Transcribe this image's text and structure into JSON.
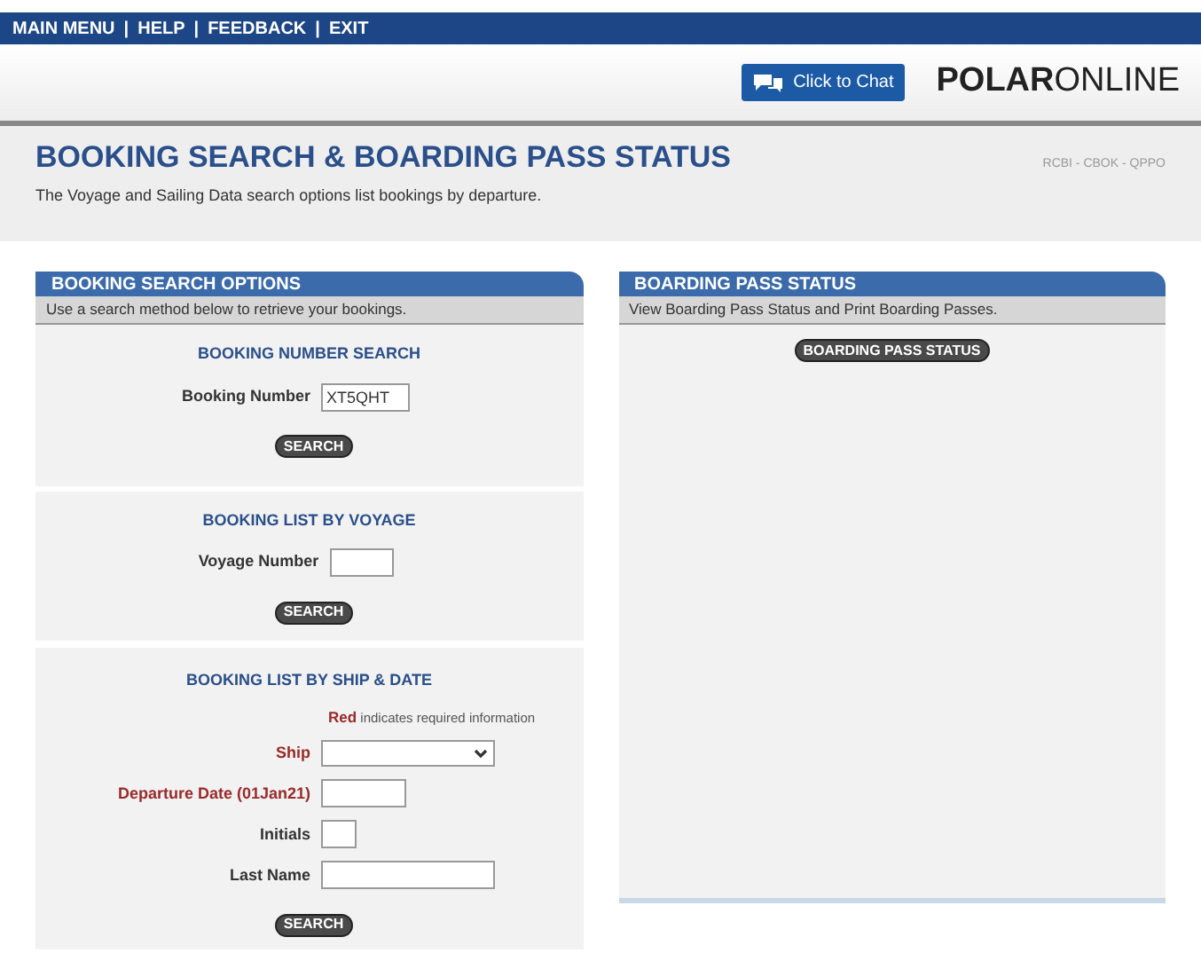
{
  "top_menu": [
    "MAIN MENU",
    "|",
    "HELP",
    "|",
    "FEEDBACK",
    "|",
    "EXIT"
  ],
  "chat_button": "Click to Chat",
  "logo": {
    "bold": "POLAR",
    "light": "ONLINE"
  },
  "page": {
    "title": "BOOKING SEARCH & BOARDING PASS STATUS",
    "subtitle": "The Voyage and Sailing Data search options list bookings by departure.",
    "code": "RCBI - CBOK - QPPO"
  },
  "left_panel": {
    "title": "BOOKING SEARCH OPTIONS",
    "description": "Use a search method below to retrieve your bookings.",
    "sections": [
      {
        "title": "BOOKING NUMBER SEARCH",
        "fields": [
          {
            "kind": "text",
            "label": "Booking Number",
            "value": "XT5QHT",
            "required": false
          }
        ],
        "button": "SEARCH"
      },
      {
        "title": "BOOKING LIST BY VOYAGE",
        "fields": [
          {
            "kind": "text",
            "label": "Voyage Number",
            "required": false
          }
        ],
        "button": "SEARCH"
      },
      {
        "title": "BOOKING LIST BY SHIP & DATE",
        "note": {
          "bold": "Red",
          "rest": "indicates required information"
        },
        "fields": [
          {
            "kind": "select",
            "label": "Ship",
            "required": true
          },
          {
            "kind": "text",
            "label": "Departure Date (01Jan21)",
            "required": true
          },
          {
            "kind": "text",
            "label": "Initials",
            "required": false
          },
          {
            "kind": "text",
            "label": "Last Name",
            "required": false
          }
        ],
        "button": "SEARCH"
      }
    ]
  },
  "right_panel": {
    "title": "BOARDING PASS STATUS",
    "description": "View Boarding Pass Status and Print Boarding Passes.",
    "button": "BOARDING PASS STATUS"
  }
}
